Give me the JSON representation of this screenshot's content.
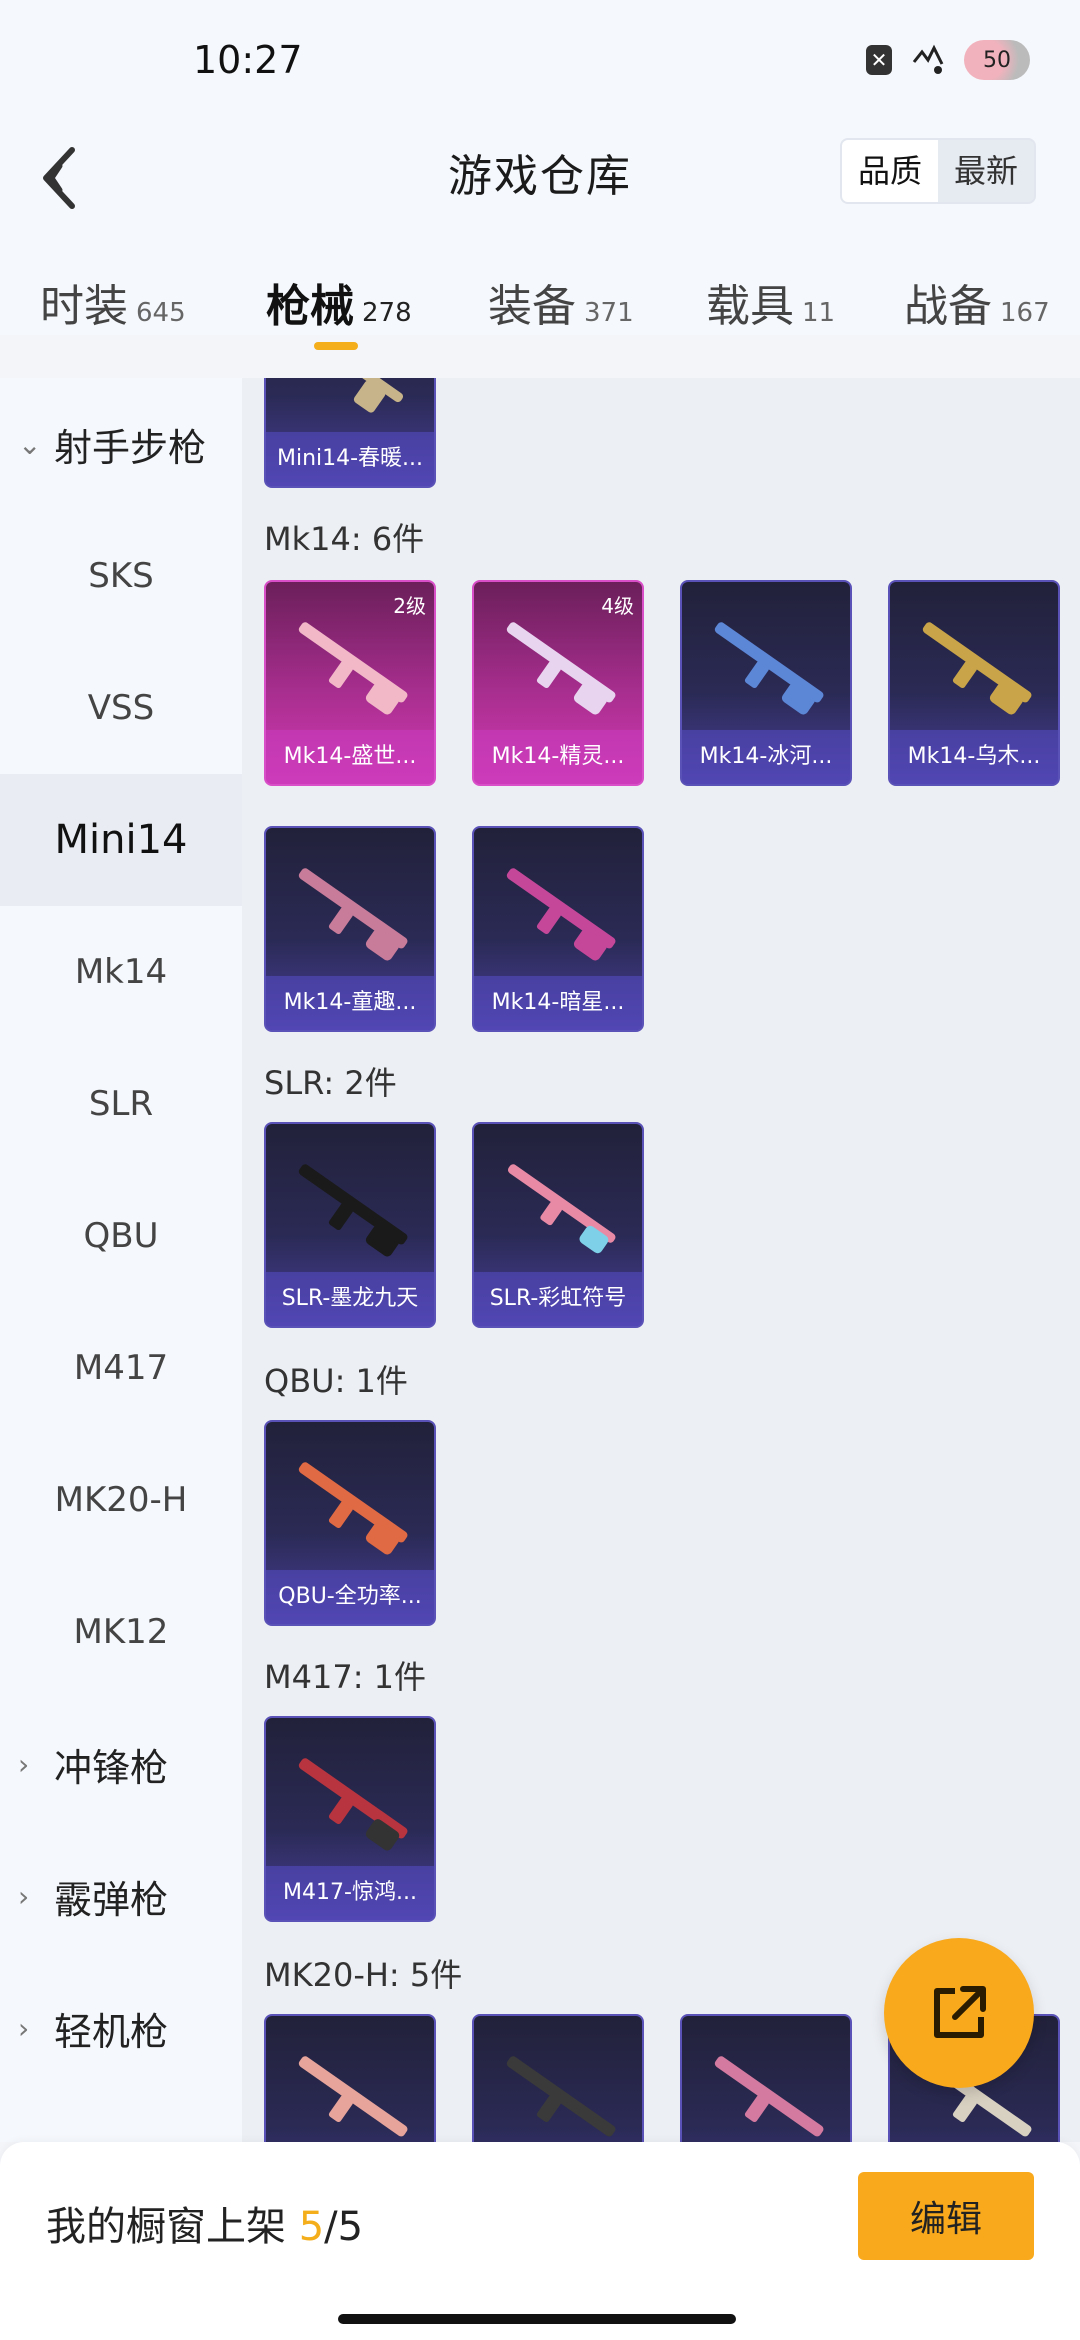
{
  "status": {
    "time": "10:27",
    "battery": "50",
    "notif_glyph": "✕"
  },
  "header": {
    "title": "游戏仓库",
    "sort_options": [
      "品质",
      "最新"
    ]
  },
  "tabs": [
    {
      "label": "时装",
      "count": "645"
    },
    {
      "label": "枪械",
      "count": "278"
    },
    {
      "label": "装备",
      "count": "371"
    },
    {
      "label": "载具",
      "count": "11"
    },
    {
      "label": "战备",
      "count": "167"
    }
  ],
  "sidebar": [
    {
      "label": "射手步枪",
      "kind": "group-open"
    },
    {
      "label": "SKS"
    },
    {
      "label": "VSS"
    },
    {
      "label": "Mini14",
      "selected": true
    },
    {
      "label": "Mk14"
    },
    {
      "label": "SLR"
    },
    {
      "label": "QBU"
    },
    {
      "label": "M417"
    },
    {
      "label": "MK20-H"
    },
    {
      "label": "MK12"
    },
    {
      "label": "冲锋枪",
      "kind": "group"
    },
    {
      "label": "霰弹枪",
      "kind": "group"
    },
    {
      "label": "轻机枪",
      "kind": "group"
    }
  ],
  "content": {
    "mini14_partial": {
      "name": "Mini14-春暖..."
    },
    "sections": [
      {
        "title": "Mk14: 6件",
        "items": [
          {
            "name": "Mk14-盛世...",
            "level": "2级",
            "rarity": "pink",
            "gun_color": "#f2b8c8"
          },
          {
            "name": "Mk14-精灵...",
            "level": "4级",
            "rarity": "pink",
            "gun_color": "#e9d4ef"
          },
          {
            "name": "Mk14-冰河...",
            "rarity": "purple",
            "gun_color": "#5c86d6"
          },
          {
            "name": "Mk14-乌木...",
            "rarity": "purple",
            "gun_color": "#c9a448"
          },
          {
            "name": "Mk14-童趣...",
            "rarity": "purple",
            "gun_color": "#c97b9a"
          },
          {
            "name": "Mk14-暗星...",
            "rarity": "purple",
            "gun_color": "#c4479a"
          }
        ]
      },
      {
        "title": "SLR: 2件",
        "items": [
          {
            "name": "SLR-墨龙九天",
            "rarity": "purple",
            "gun_color": "#1a1a1a"
          },
          {
            "name": "SLR-彩虹符号",
            "rarity": "purple",
            "gun_color": "#e88aa6"
          }
        ]
      },
      {
        "title": "QBU: 1件",
        "items": [
          {
            "name": "QBU-全功率...",
            "rarity": "purple",
            "gun_color": "#e06a43"
          }
        ]
      },
      {
        "title": "M417: 1件",
        "items": [
          {
            "name": "M417-惊鸿...",
            "rarity": "purple",
            "gun_color": "#b8343f"
          }
        ]
      },
      {
        "title": "MK20-H: 5件",
        "items": [
          {
            "name": "",
            "rarity": "purple",
            "gun_color": "#e7a49a"
          },
          {
            "name": "",
            "rarity": "purple",
            "gun_color": "#3a3a3a"
          },
          {
            "name": "",
            "rarity": "purple",
            "gun_color": "#d47aa0"
          },
          {
            "name": "",
            "rarity": "purple",
            "gun_color": "#d8d0c0"
          }
        ]
      }
    ]
  },
  "bottom": {
    "shelf_label": "我的橱窗上架",
    "shelf_current": "5",
    "shelf_sep_total": "/5",
    "edit_label": "编辑"
  },
  "colors": {
    "accent": "#f9a91c",
    "pink_rarity": "#d43bb4",
    "purple_rarity": "#4a3f9b"
  }
}
